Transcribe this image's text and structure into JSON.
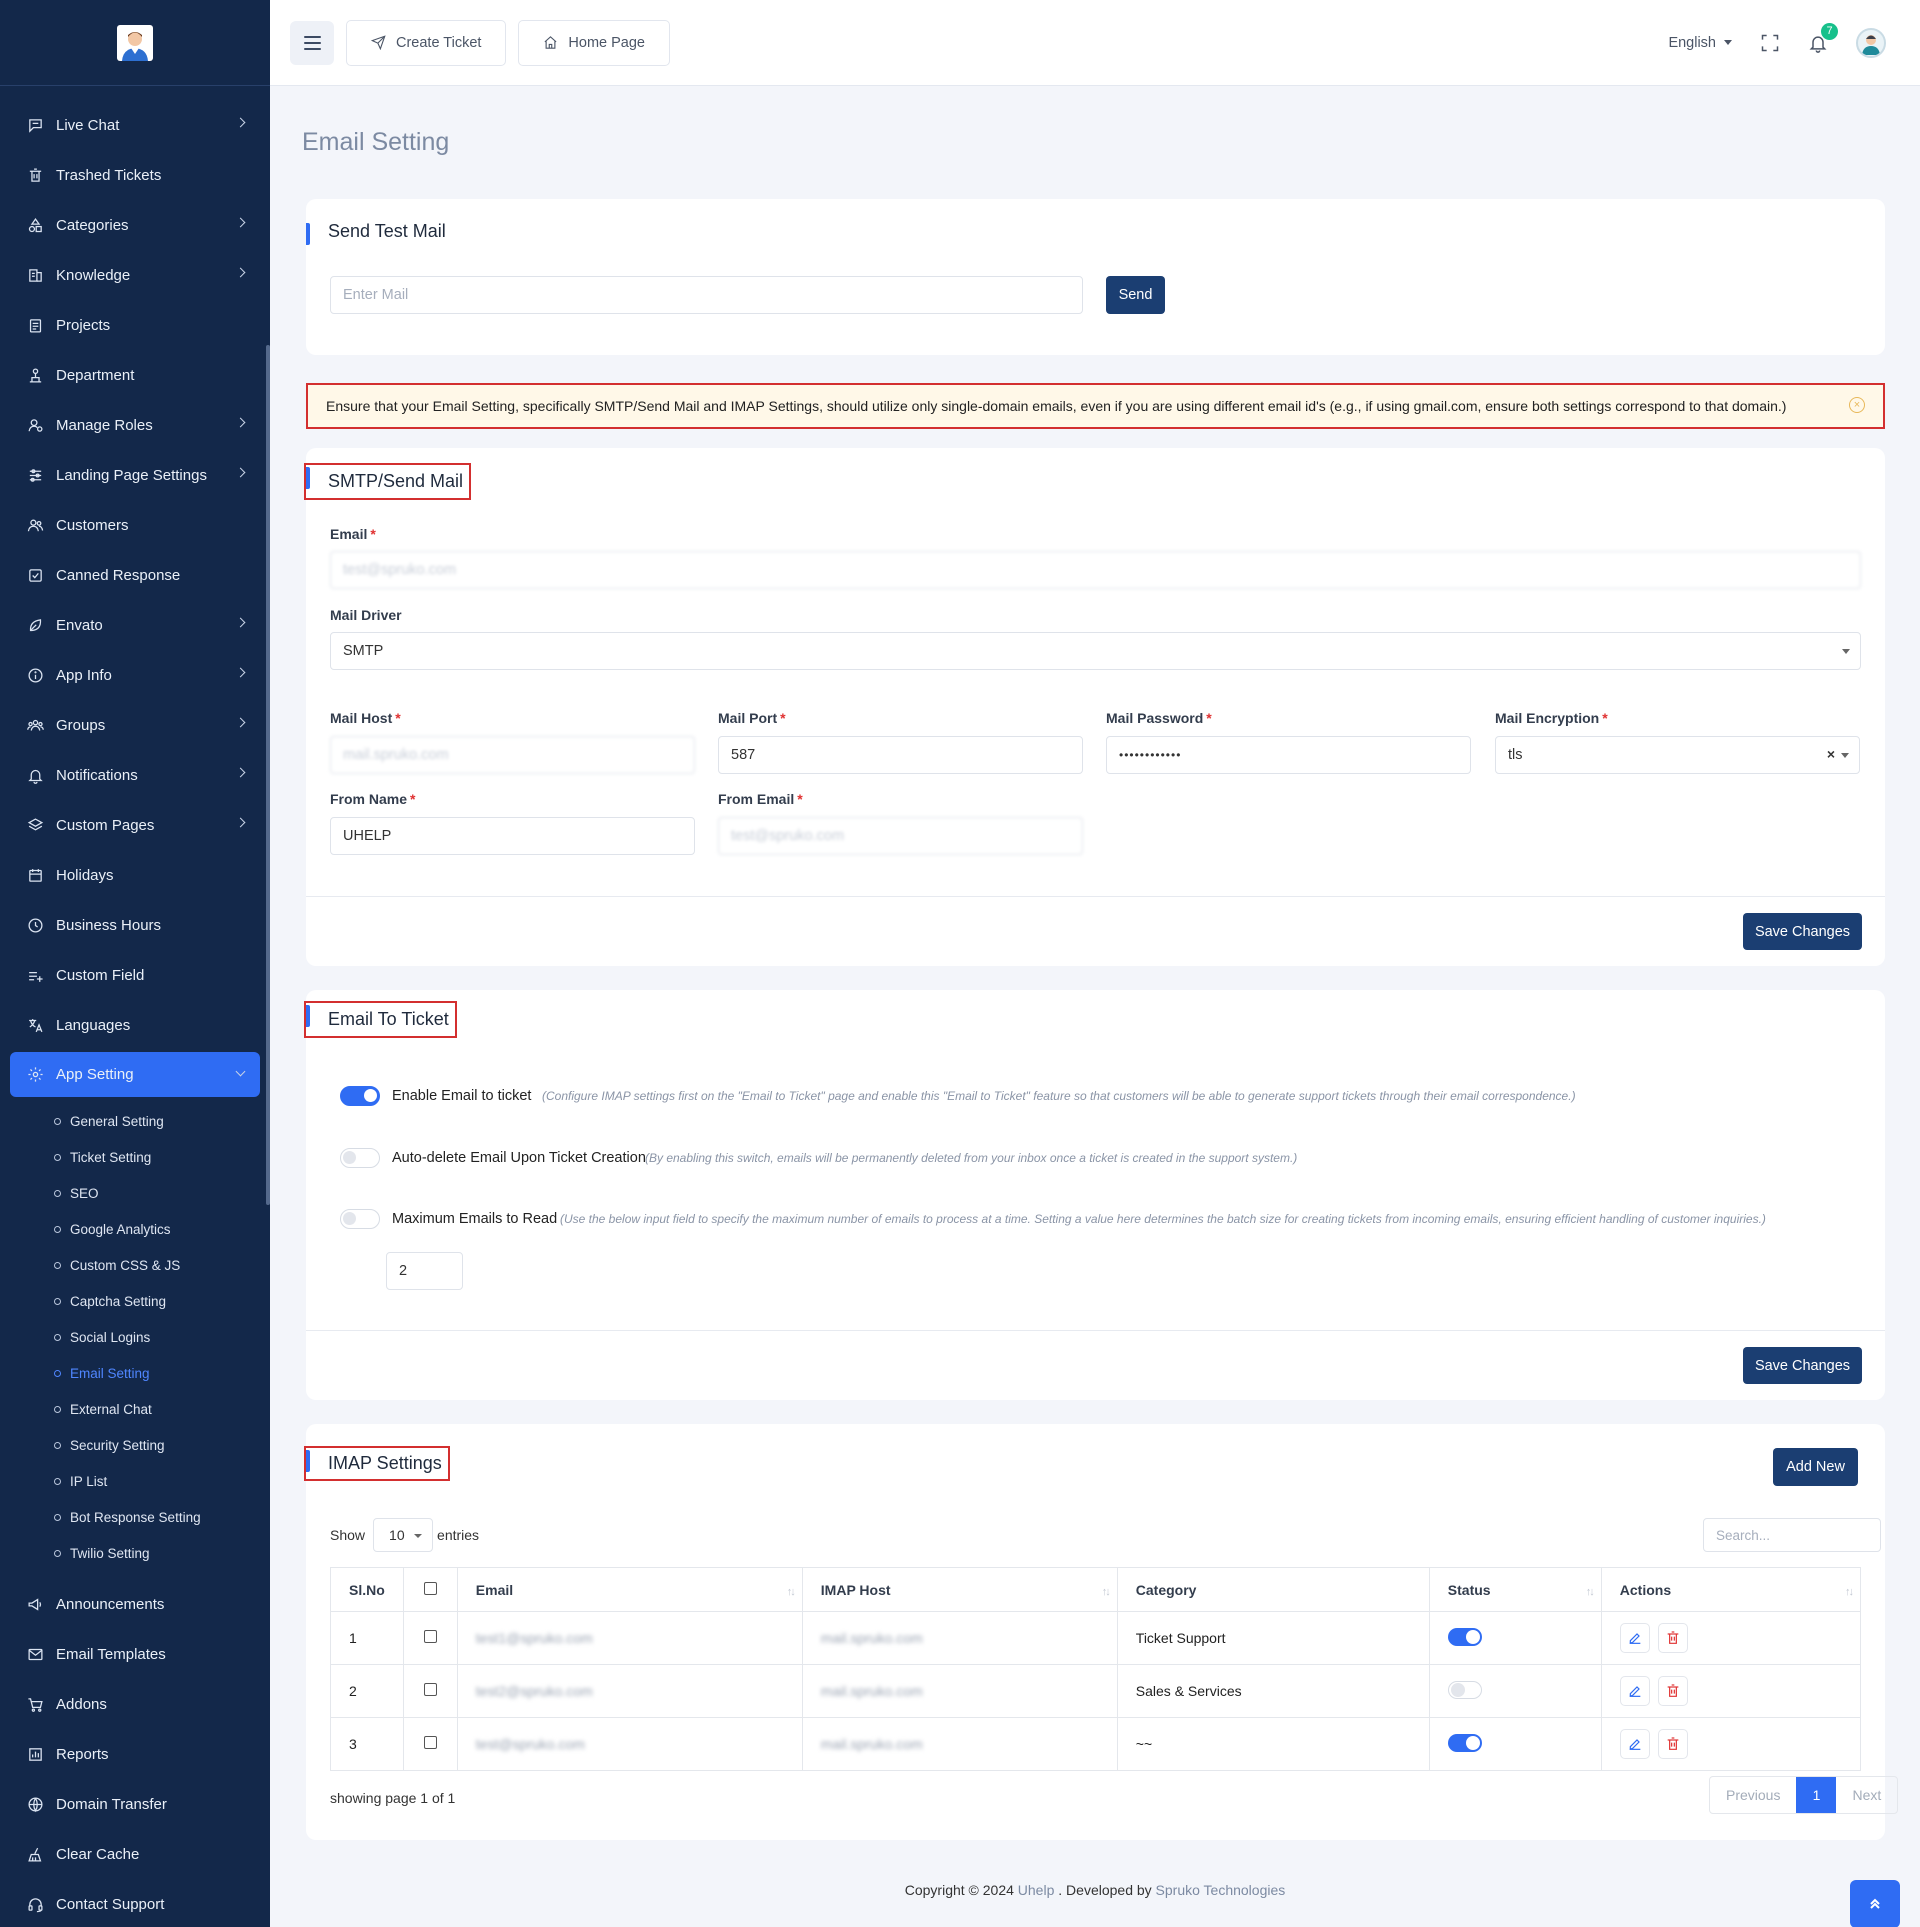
{
  "header": {
    "create_ticket": "Create Ticket",
    "home_page": "Home Page",
    "language": "English",
    "notification_count": "7"
  },
  "sidebar": {
    "items": [
      {
        "label": "Live Chat",
        "icon": "chat-icon",
        "chevron": true
      },
      {
        "label": "Trashed Tickets",
        "icon": "trash-icon",
        "chevron": false
      },
      {
        "label": "Categories",
        "icon": "shapes-icon",
        "chevron": true
      },
      {
        "label": "Knowledge",
        "icon": "book-icon",
        "chevron": true
      },
      {
        "label": "Projects",
        "icon": "clipboard-icon",
        "chevron": false
      },
      {
        "label": "Department",
        "icon": "department-icon",
        "chevron": false
      },
      {
        "label": "Manage Roles",
        "icon": "user-roles-icon",
        "chevron": true
      },
      {
        "label": "Landing Page Settings",
        "icon": "sliders-icon",
        "chevron": true
      },
      {
        "label": "Customers",
        "icon": "users-icon",
        "chevron": false
      },
      {
        "label": "Canned Response",
        "icon": "check-square-icon",
        "chevron": false
      },
      {
        "label": "Envato",
        "icon": "leaf-icon",
        "chevron": true
      },
      {
        "label": "App Info",
        "icon": "info-icon",
        "chevron": true
      },
      {
        "label": "Groups",
        "icon": "group-icon",
        "chevron": true
      },
      {
        "label": "Notifications",
        "icon": "bell-icon",
        "chevron": true
      },
      {
        "label": "Custom Pages",
        "icon": "layers-icon",
        "chevron": true
      },
      {
        "label": "Holidays",
        "icon": "calendar-icon",
        "chevron": false
      },
      {
        "label": "Business Hours",
        "icon": "clock-icon",
        "chevron": false
      },
      {
        "label": "Custom Field",
        "icon": "field-add-icon",
        "chevron": false
      },
      {
        "label": "Languages",
        "icon": "translate-icon",
        "chevron": false
      }
    ],
    "active": {
      "label": "App Setting",
      "icon": "gear-icon"
    },
    "sub_items": [
      "General Setting",
      "Ticket Setting",
      "SEO",
      "Google Analytics",
      "Custom CSS & JS",
      "Captcha Setting",
      "Social Logins",
      "Email Setting",
      "External Chat",
      "Security Setting",
      "IP List",
      "Bot Response Setting",
      "Twilio Setting"
    ],
    "current_sub": "Email Setting",
    "bottom_items": [
      {
        "label": "Announcements",
        "icon": "megaphone-icon"
      },
      {
        "label": "Email Templates",
        "icon": "mail-icon"
      },
      {
        "label": "Addons",
        "icon": "cart-icon"
      },
      {
        "label": "Reports",
        "icon": "chart-icon"
      },
      {
        "label": "Domain Transfer",
        "icon": "globe-icon"
      },
      {
        "label": "Clear Cache",
        "icon": "broom-icon"
      },
      {
        "label": "Contact Support",
        "icon": "headset-icon"
      }
    ]
  },
  "page": {
    "title": "Email Setting"
  },
  "test_mail": {
    "title": "Send Test Mail",
    "placeholder": "Enter Mail",
    "send": "Send"
  },
  "alert": {
    "text": "Ensure that your Email Setting, specifically SMTP/Send Mail and IMAP Settings, should utilize only single-domain emails, even if you are using different email id's (e.g., if using gmail.com, ensure both settings correspond to that domain.)"
  },
  "smtp": {
    "title": "SMTP/Send Mail",
    "email_label": "Email",
    "email_value": "test@spruko.com",
    "driver_label": "Mail Driver",
    "driver_value": "SMTP",
    "host_label": "Mail Host",
    "host_value": "mail.spruko.com",
    "port_label": "Mail Port",
    "port_value": "587",
    "password_label": "Mail Password",
    "password_value": "••••••••••••",
    "encryption_label": "Mail Encryption",
    "encryption_value": "tls",
    "from_name_label": "From Name",
    "from_name_value": "UHELP",
    "from_email_label": "From Email",
    "from_email_value": "test@spruko.com",
    "save": "Save Changes"
  },
  "email_to_ticket": {
    "title": "Email To Ticket",
    "options": [
      {
        "label": "Enable Email to ticket",
        "on": true,
        "help": "(Configure IMAP settings first on the \"Email to Ticket\" page and enable this \"Email to Ticket\" feature so that customers will be able to generate support tickets through their email correspondence.)"
      },
      {
        "label": "Auto-delete Email Upon Ticket Creation",
        "on": false,
        "help": "(By enabling this switch, emails will be permanently deleted from your inbox once a ticket is created in the support system.)"
      },
      {
        "label": "Maximum Emails to Read",
        "on": false,
        "help": "(Use the below input field to specify the maximum number of emails to process at a time. Setting a value here determines the batch size for creating tickets from incoming emails, ensuring efficient handling of customer inquiries.)"
      }
    ],
    "max_value": "2",
    "save": "Save Changes"
  },
  "imap": {
    "title": "IMAP Settings",
    "add_new": "Add New",
    "show": "Show",
    "entries_value": "10",
    "entries": "entries",
    "search_placeholder": "Search...",
    "columns": [
      "Sl.No",
      "",
      "Email",
      "IMAP Host",
      "Category",
      "Status",
      "Actions"
    ],
    "rows": [
      {
        "sl": "1",
        "email": "test1@spruko.com",
        "host": "mail.spruko.com",
        "category": "Ticket Support",
        "status": true
      },
      {
        "sl": "2",
        "email": "test2@spruko.com",
        "host": "mail.spruko.com",
        "category": "Sales & Services",
        "status": false
      },
      {
        "sl": "3",
        "email": "test@spruko.com",
        "host": "mail.spruko.com",
        "category": "~~",
        "status": true
      }
    ],
    "showing": "showing page 1 of 1",
    "previous": "Previous",
    "page": "1",
    "next": "Next"
  },
  "footer": {
    "prefix": "Copyright © 2024 ",
    "brand": "Uhelp",
    "middle": " . Developed by ",
    "company": "Spruko Technologies"
  }
}
